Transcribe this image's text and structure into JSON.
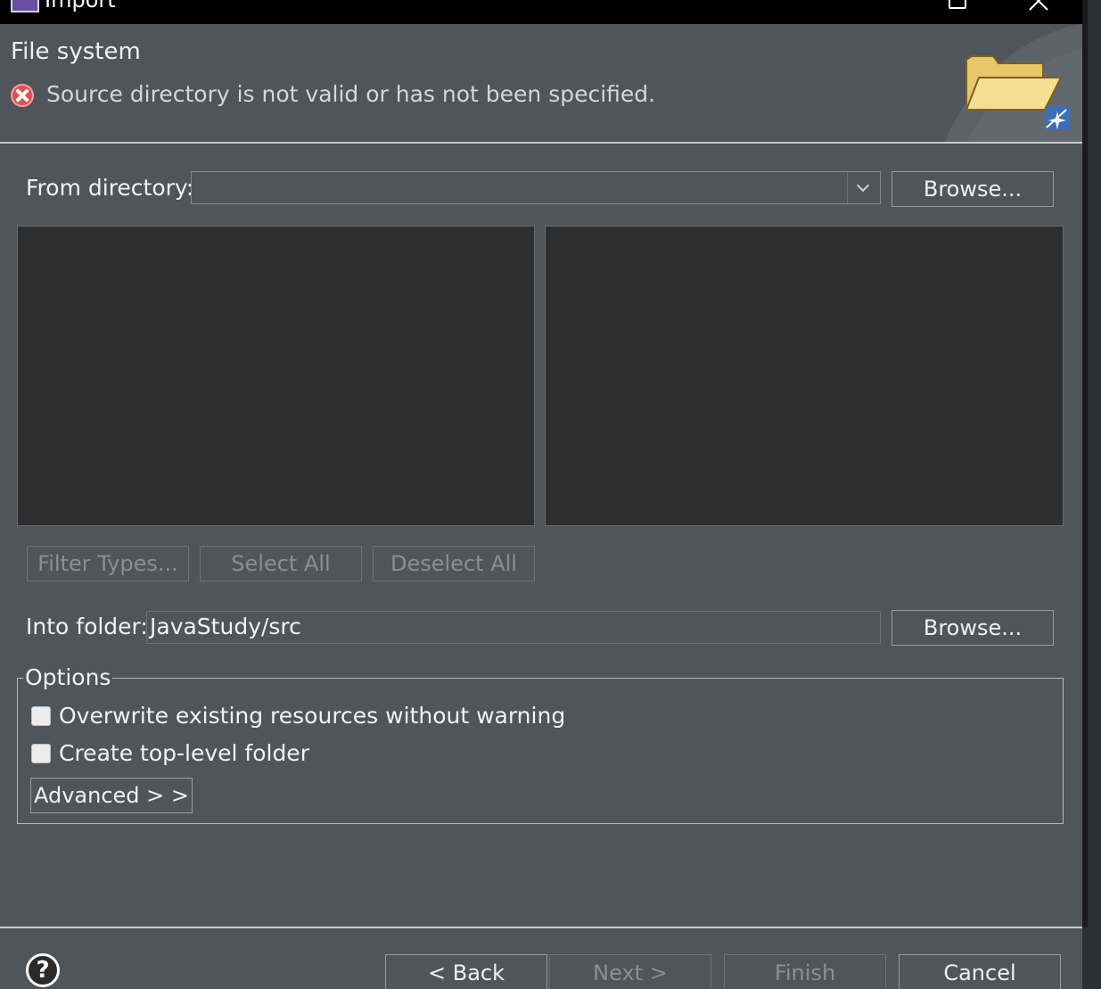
{
  "window": {
    "title": "Import"
  },
  "banner": {
    "title": "File system",
    "message": "Source directory is not valid or has not been specified."
  },
  "source": {
    "label": "From directory:",
    "value": "",
    "browse_label": "Browse..."
  },
  "selection_buttons": {
    "filter_types": "Filter Types...",
    "select_all": "Select All",
    "deselect_all": "Deselect All"
  },
  "destination": {
    "label": "Into folder:",
    "value": "JavaStudy/src",
    "browse_label": "Browse..."
  },
  "options": {
    "title": "Options",
    "overwrite": {
      "label": "Overwrite existing resources without warning",
      "checked": false
    },
    "create_folder": {
      "label": "Create top-level folder",
      "checked": false
    },
    "advanced_label": "Advanced > >"
  },
  "footer": {
    "back_label": "< Back",
    "next_label": "Next >",
    "finish_label": "Finish",
    "cancel_label": "Cancel"
  },
  "colors": {
    "background": "#505559",
    "pane": "#2f2f2f",
    "error": "#e05050"
  }
}
